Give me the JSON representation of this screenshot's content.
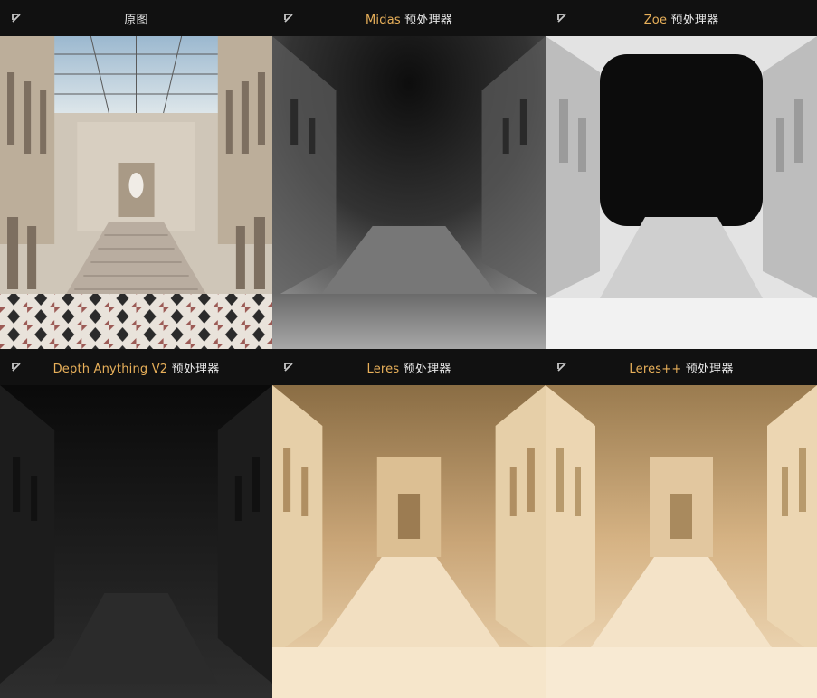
{
  "panels": [
    {
      "title_en": "",
      "title_zh": "原图"
    },
    {
      "title_en": "Midas",
      "title_zh": " 预处理器"
    },
    {
      "title_en": "Zoe",
      "title_zh": " 预处理器"
    },
    {
      "title_en": "Depth Anything V2",
      "title_zh": " 预处理器"
    },
    {
      "title_en": "Leres",
      "title_zh": " 预处理器"
    },
    {
      "title_en": "Leres++",
      "title_zh": " 预处理器"
    }
  ],
  "icons": {
    "expand": "arrow-up-left-icon"
  },
  "colors": {
    "accent": "#e8b05a",
    "selected_border": "#e39a3b"
  },
  "selected_panel": "Leres 预处理器"
}
